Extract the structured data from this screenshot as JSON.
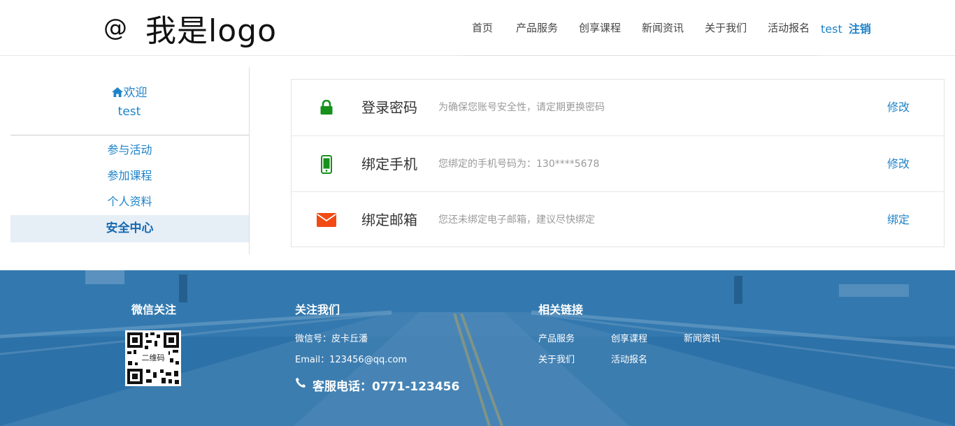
{
  "header": {
    "logo_symbol": "@",
    "logo_text": "我是logo",
    "nav": [
      "首页",
      "产品服务",
      "创享课程",
      "新闻资讯",
      "关于我们",
      "活动报名"
    ],
    "username": "test",
    "logout_label": "注销"
  },
  "sidebar": {
    "welcome_label": "欢迎",
    "username": "test",
    "items": [
      "参与活动",
      "参加课程",
      "个人资料",
      "安全中心"
    ],
    "active_item": "安全中心"
  },
  "security": {
    "rows": [
      {
        "icon": "lock-icon",
        "title": "登录密码",
        "desc": "为确保您账号安全性，请定期更换密码",
        "action": "修改",
        "icon_color": "#17901c"
      },
      {
        "icon": "mobile-phone-icon",
        "title": "绑定手机",
        "desc": "您绑定的手机号码为：130****5678",
        "action": "修改",
        "icon_color": "#17901c"
      },
      {
        "icon": "envelope-icon",
        "title": "绑定邮箱",
        "desc": "您还未绑定电子邮箱，建议尽快绑定",
        "action": "绑定",
        "icon_color": "#f24a14"
      }
    ]
  },
  "footer": {
    "wechat": {
      "title": "微信关注",
      "qr_label": "二维码"
    },
    "follow": {
      "title": "关注我们",
      "wechat_id": "微信号：皮卡丘潘",
      "email": "Email：123456@qq.com",
      "phone": "客服电话：0771-123456"
    },
    "links": {
      "title": "相关链接",
      "items": [
        "产品服务",
        "创享课程",
        "新闻资讯",
        "关于我们",
        "活动报名"
      ]
    }
  },
  "colors": {
    "accent": "#1e83c9",
    "footer_bg": "#2b6fa6",
    "sidebar_active_bg": "#e6eef6"
  }
}
